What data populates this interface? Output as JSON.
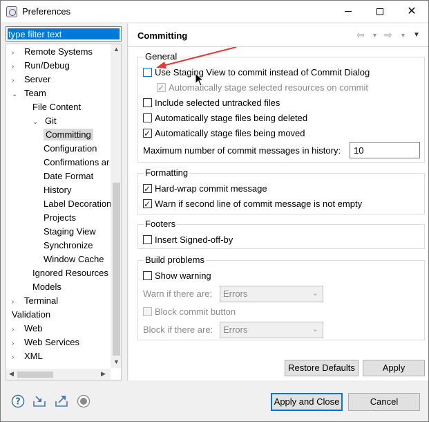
{
  "window": {
    "title": "Preferences"
  },
  "filter": {
    "value": "type filter text"
  },
  "tree": [
    {
      "label": "Remote Systems",
      "arrow": "›",
      "level": 0
    },
    {
      "label": "Run/Debug",
      "arrow": "›",
      "level": 0
    },
    {
      "label": "Server",
      "arrow": "›",
      "level": 0
    },
    {
      "label": "Team",
      "arrow": "⌄",
      "level": 0
    },
    {
      "label": "File Content",
      "arrow": "",
      "level": 1
    },
    {
      "label": "Git",
      "arrow": "⌄",
      "level": 1
    },
    {
      "label": "Committing",
      "arrow": "",
      "level": 2,
      "selected": true
    },
    {
      "label": "Configuration",
      "arrow": "",
      "level": 2
    },
    {
      "label": "Confirmations ar",
      "arrow": "",
      "level": 2
    },
    {
      "label": "Date Format",
      "arrow": "",
      "level": 2
    },
    {
      "label": "History",
      "arrow": "",
      "level": 2
    },
    {
      "label": "Label Decoration",
      "arrow": "",
      "level": 2
    },
    {
      "label": "Projects",
      "arrow": "",
      "level": 2
    },
    {
      "label": "Staging View",
      "arrow": "",
      "level": 2
    },
    {
      "label": "Synchronize",
      "arrow": "",
      "level": 2
    },
    {
      "label": "Window Cache",
      "arrow": "",
      "level": 2
    },
    {
      "label": "Ignored Resources",
      "arrow": "",
      "level": 1
    },
    {
      "label": "Models",
      "arrow": "",
      "level": 1
    },
    {
      "label": "Terminal",
      "arrow": "›",
      "level": 0
    },
    {
      "label": "Validation",
      "arrow": "",
      "level": 0
    },
    {
      "label": "Web",
      "arrow": "›",
      "level": 0
    },
    {
      "label": "Web Services",
      "arrow": "›",
      "level": 0
    },
    {
      "label": "XML",
      "arrow": "›",
      "level": 0
    }
  ],
  "page": {
    "title": "Committing"
  },
  "general": {
    "legend": "General",
    "use_staging_view": {
      "label": "Use Staging View to commit instead of Commit Dialog",
      "checked": false
    },
    "auto_stage_selected": {
      "label": "Automatically stage selected resources on commit",
      "checked": true,
      "disabled": true
    },
    "include_untracked": {
      "label": "Include selected untracked files",
      "checked": false
    },
    "auto_stage_deleted": {
      "label": "Automatically stage files being deleted",
      "checked": false
    },
    "auto_stage_moved": {
      "label": "Automatically stage files being moved",
      "checked": true
    },
    "max_messages_label": "Maximum number of commit messages in history:",
    "max_messages_value": "10"
  },
  "formatting": {
    "legend": "Formatting",
    "hard_wrap": {
      "label": "Hard-wrap commit message",
      "checked": true
    },
    "warn_second_line": {
      "label": "Warn if second line of commit message is not empty",
      "checked": true
    }
  },
  "footers": {
    "legend": "Footers",
    "signed_off": {
      "label": "Insert Signed-off-by",
      "checked": false
    }
  },
  "build_problems": {
    "legend": "Build problems",
    "show_warning": {
      "label": "Show warning",
      "checked": false
    },
    "warn_label": "Warn if there are:",
    "warn_value": "Errors",
    "block_commit": {
      "label": "Block commit button",
      "checked": false
    },
    "block_label": "Block if there are:",
    "block_value": "Errors"
  },
  "buttons": {
    "restore_defaults": "Restore Defaults",
    "apply": "Apply",
    "apply_and_close": "Apply and Close",
    "cancel": "Cancel"
  },
  "colors": {
    "accent": "#0078d7",
    "annotation_arrow": "#e53935"
  }
}
